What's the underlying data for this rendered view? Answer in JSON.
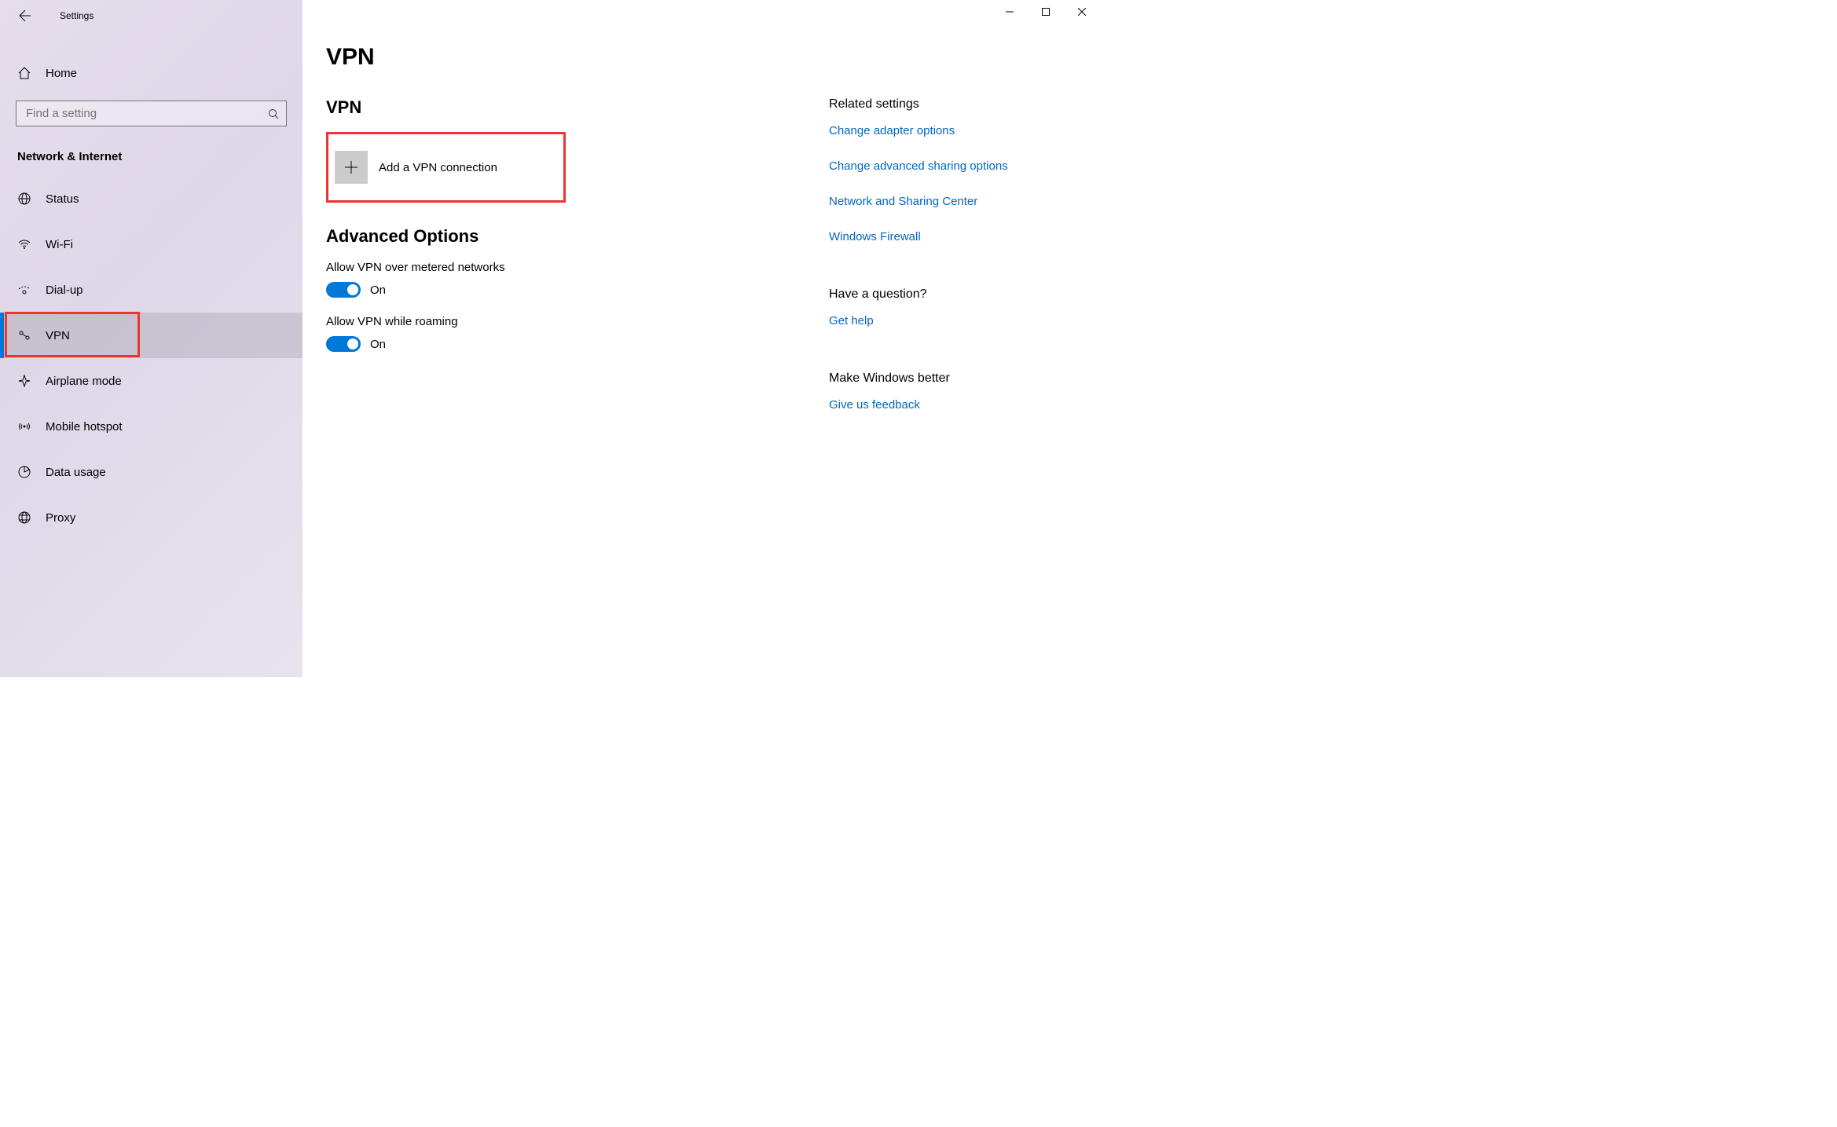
{
  "titlebar": {
    "title": "Settings"
  },
  "sidebar": {
    "home_label": "Home",
    "search_placeholder": "Find a setting",
    "section_header": "Network & Internet",
    "items": [
      {
        "label": "Status"
      },
      {
        "label": "Wi-Fi"
      },
      {
        "label": "Dial-up"
      },
      {
        "label": "VPN"
      },
      {
        "label": "Airplane mode"
      },
      {
        "label": "Mobile hotspot"
      },
      {
        "label": "Data usage"
      },
      {
        "label": "Proxy"
      }
    ]
  },
  "main": {
    "page_title": "VPN",
    "vpn_heading": "VPN",
    "add_vpn_label": "Add a VPN connection",
    "advanced_heading": "Advanced Options",
    "metered_label": "Allow VPN over metered networks",
    "metered_state": "On",
    "roaming_label": "Allow VPN while roaming",
    "roaming_state": "On"
  },
  "aside": {
    "related_heading": "Related settings",
    "related_links": [
      "Change adapter options",
      "Change advanced sharing options",
      "Network and Sharing Center",
      "Windows Firewall"
    ],
    "question_heading": "Have a question?",
    "help_link": "Get help",
    "feedback_heading": "Make Windows better",
    "feedback_link": "Give us feedback"
  }
}
